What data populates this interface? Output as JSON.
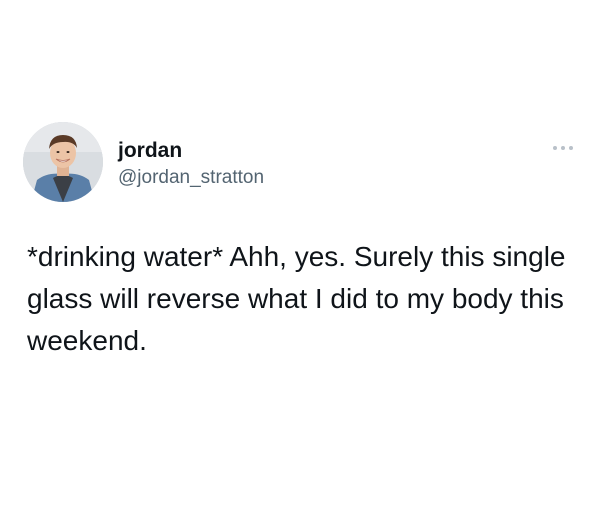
{
  "tweet": {
    "author": {
      "display_name": "jordan",
      "handle": "@jordan_stratton",
      "avatar_icon": "profile-photo"
    },
    "more_icon": "ellipsis-icon",
    "text": "*drinking water* Ahh, yes. Surely this single glass will reverse what I did to my body this weekend."
  }
}
